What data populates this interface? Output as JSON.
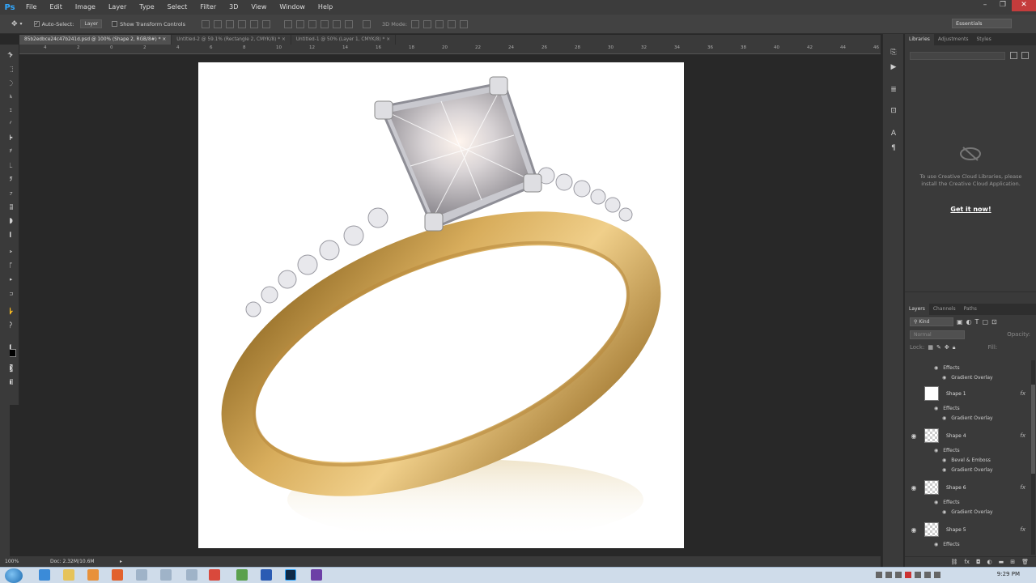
{
  "app": {
    "logo": "Ps"
  },
  "menu": [
    "File",
    "Edit",
    "Image",
    "Layer",
    "Type",
    "Select",
    "Filter",
    "3D",
    "View",
    "Window",
    "Help"
  ],
  "options": {
    "auto_select_label": "Auto-Select:",
    "auto_select_value": "Layer",
    "transform_label": "Show Transform Controls",
    "mode_3d_label": "3D Mode:",
    "workspace": "Essentials"
  },
  "tabs": [
    {
      "label": "85b2edbce24c47b241d.psd @ 100% (Shape 2, RGB/8#) *",
      "active": true
    },
    {
      "label": "Untitled-2 @ 59.1% (Rectangle 2, CMYK/8) *",
      "active": false
    },
    {
      "label": "Untitled-1 @ 50% (Layer 1, CMYK/8) *",
      "active": false
    }
  ],
  "ruler": [
    "4",
    "2",
    "0",
    "2",
    "4",
    "6",
    "8",
    "10",
    "12",
    "14",
    "16",
    "18",
    "20",
    "22",
    "24",
    "26",
    "28",
    "30",
    "32",
    "34",
    "36",
    "38",
    "40",
    "42",
    "44",
    "46"
  ],
  "status": {
    "zoom": "100%",
    "doc": "Doc: 2.32M/10.6M"
  },
  "libraries": {
    "tabs": [
      "Libraries",
      "Adjustments",
      "Styles"
    ],
    "message": "To use Creative Cloud Libraries, please install the Creative Cloud Application.",
    "link": "Get it now!"
  },
  "layers": {
    "tabs": [
      "Layers",
      "Channels",
      "Paths"
    ],
    "filter": "Kind",
    "blend": "Normal",
    "opacity_label": "Opacity:",
    "lock_label": "Lock:",
    "fill_label": "Fill:",
    "effects_label": "Effects",
    "grad_label": "Gradient Overlay",
    "bevel_label": "Bevel & Emboss",
    "items": [
      {
        "name": "Shape 1"
      },
      {
        "name": "Shape 4"
      },
      {
        "name": "Shape 6"
      },
      {
        "name": "Shape 5"
      }
    ]
  },
  "clock": "9:29 PM"
}
